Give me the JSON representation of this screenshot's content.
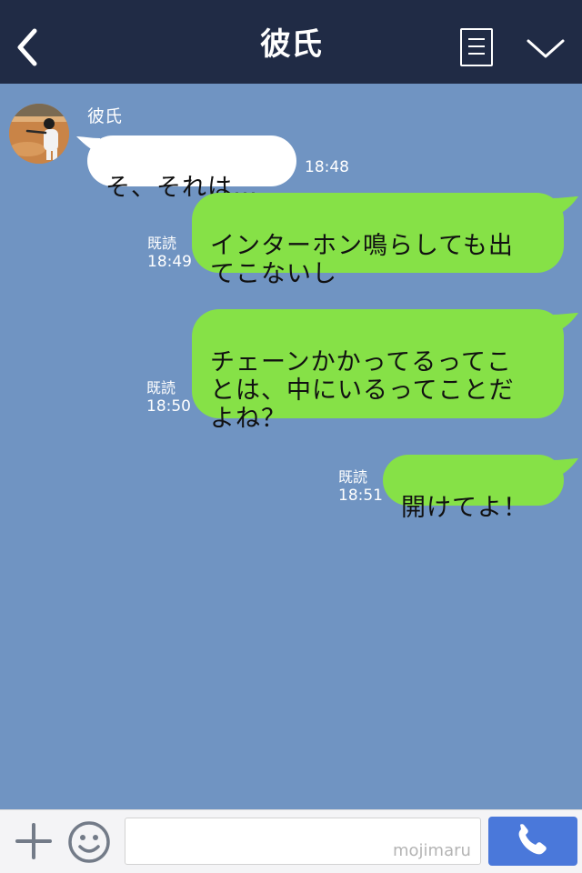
{
  "header": {
    "title": "彼氏",
    "back_icon": "chevron-left-icon",
    "menu_icon": "menu-list-icon",
    "more_icon": "chevron-down-icon",
    "background": "#202b45"
  },
  "chat": {
    "background": "#7094c2",
    "incoming_bubble_color": "#ffffff",
    "outgoing_bubble_color": "#86e147",
    "messages": [
      {
        "direction": "in",
        "sender": "彼氏",
        "text": "そ、それは…",
        "time": "18:48"
      },
      {
        "direction": "out",
        "read": "既読",
        "text": "インターホン鳴らしても出\nてこないし",
        "time": "18:49"
      },
      {
        "direction": "out",
        "read": "既読",
        "text": "チェーンかかってるってこ\nとは、中にいるってことだ\nよね？",
        "time": "18:50"
      },
      {
        "direction": "out",
        "read": "既読",
        "text": "開けてよ！",
        "time": "18:51"
      }
    ]
  },
  "bottom_bar": {
    "plus_icon": "plus-icon",
    "emoji_icon": "smiley-icon",
    "input_value": "",
    "watermark": "mojimaru",
    "call_icon": "phone-icon",
    "call_button_color": "#4a78da"
  }
}
